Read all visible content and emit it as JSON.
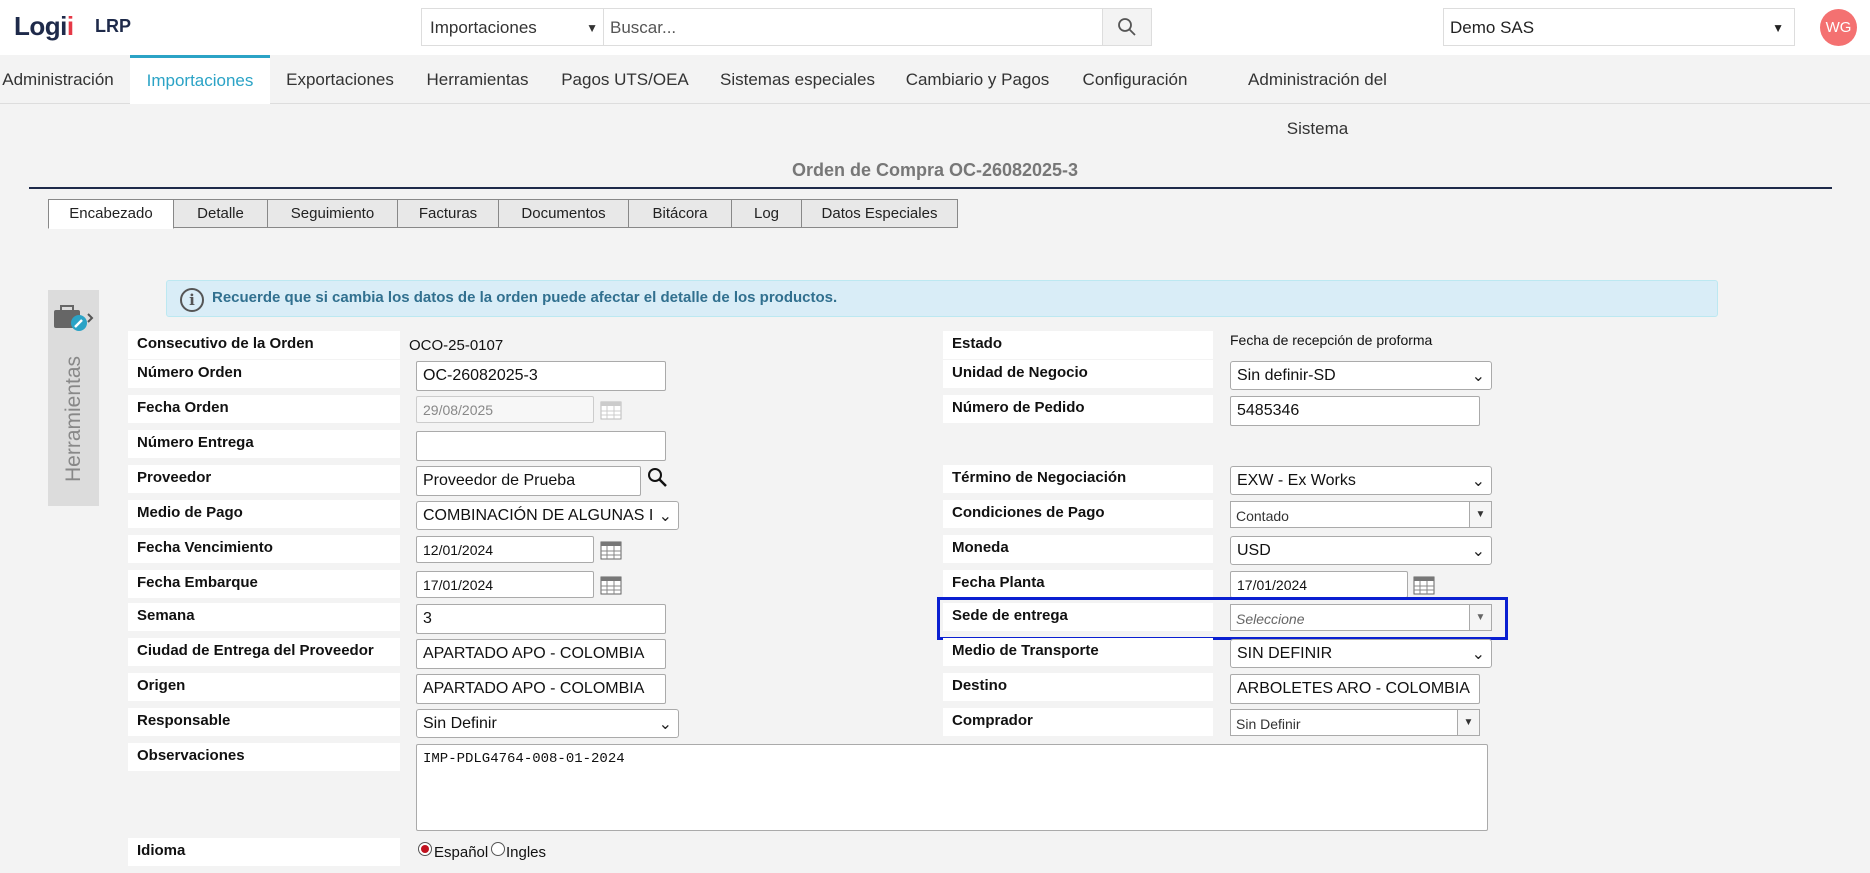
{
  "header": {
    "logo_main": "Logi",
    "logo_accent": "i",
    "logo_sub": "LRP",
    "module_select": "Importaciones",
    "search_placeholder": "Buscar...",
    "company": "Demo SAS",
    "avatar_initials": "WG"
  },
  "nav": [
    {
      "label": "Administración"
    },
    {
      "label": "Importaciones",
      "active": true
    },
    {
      "label": "Exportaciones"
    },
    {
      "label": "Herramientas"
    },
    {
      "label": "Pagos UTS/OEA"
    },
    {
      "label": "Sistemas especiales"
    },
    {
      "label": "Cambiario y Pagos"
    },
    {
      "label": "Configuración"
    },
    {
      "label": "Administración del Sistema"
    }
  ],
  "page_title": "Orden de Compra OC-26082025-3",
  "tabs": [
    {
      "label": "Encabezado",
      "active": true
    },
    {
      "label": "Detalle"
    },
    {
      "label": "Seguimiento"
    },
    {
      "label": "Facturas"
    },
    {
      "label": "Documentos"
    },
    {
      "label": "Bitácora"
    },
    {
      "label": "Log"
    },
    {
      "label": "Datos Especiales"
    }
  ],
  "side_tools_label": "Herramientas",
  "alert_text": "Recuerde que si cambia los datos de la orden puede afectar el detalle de los productos.",
  "form": {
    "consecutivo_label": "Consecutivo de la Orden",
    "consecutivo_value": "OCO-25-0107",
    "numero_orden_label": "Número Orden",
    "numero_orden_value": "OC-26082025-3",
    "fecha_orden_label": "Fecha Orden",
    "fecha_orden_value": "29/08/2025",
    "numero_entrega_label": "Número Entrega",
    "numero_entrega_value": "",
    "proveedor_label": "Proveedor",
    "proveedor_value": "Proveedor de Prueba",
    "medio_pago_label": "Medio de Pago",
    "medio_pago_value": "COMBINACIÓN DE ALGUNAS I",
    "fecha_vencimiento_label": "Fecha Vencimiento",
    "fecha_vencimiento_value": "12/01/2024",
    "fecha_embarque_label": "Fecha Embarque",
    "fecha_embarque_value": "17/01/2024",
    "semana_label": "Semana",
    "semana_value": "3",
    "ciudad_entrega_label": "Ciudad de Entrega del Proveedor",
    "ciudad_entrega_value": "APARTADO APO - COLOMBIA",
    "origen_label": "Origen",
    "origen_value": "APARTADO APO - COLOMBIA",
    "responsable_label": "Responsable",
    "responsable_value": "Sin Definir",
    "observaciones_label": "Observaciones",
    "observaciones_value": "IMP-PDLG4764-008-01-2024",
    "idioma_label": "Idioma",
    "idioma_option1": "Español",
    "idioma_option2": "Ingles",
    "estado_label": "Estado",
    "estado_value": "Fecha de recepción de proforma",
    "unidad_negocio_label": "Unidad de Negocio",
    "unidad_negocio_value": "Sin definir-SD",
    "numero_pedido_label": "Número de Pedido",
    "numero_pedido_value": "5485346",
    "termino_negociacion_label": "Término de Negociación",
    "termino_negociacion_value": "EXW - Ex Works",
    "condiciones_pago_label": "Condiciones de Pago",
    "condiciones_pago_value": "Contado",
    "moneda_label": "Moneda",
    "moneda_value": "USD",
    "fecha_planta_label": "Fecha Planta",
    "fecha_planta_value": "17/01/2024",
    "sede_entrega_label": "Sede de entrega",
    "sede_entrega_placeholder": "Seleccione",
    "medio_transporte_label": "Medio de Transporte",
    "medio_transporte_value": "SIN DEFINIR",
    "destino_label": "Destino",
    "destino_value": "ARBOLETES ARO - COLOMBIA",
    "comprador_label": "Comprador",
    "comprador_value": "Sin Definir"
  }
}
